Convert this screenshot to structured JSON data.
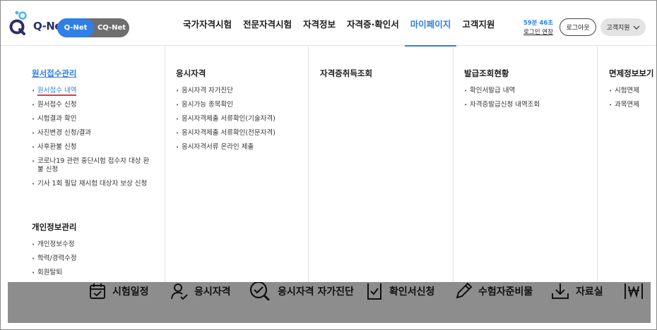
{
  "header": {
    "logo_text": "Q-Net",
    "switch": {
      "qnet": "Q-Net",
      "cqnet": "CQ-Net"
    },
    "nav": [
      {
        "label": "국가자격시험",
        "active": false
      },
      {
        "label": "전문자격시험",
        "active": false
      },
      {
        "label": "자격정보",
        "active": false
      },
      {
        "label": "자격증·확인서",
        "active": false
      },
      {
        "label": "마이페이지",
        "active": true
      },
      {
        "label": "고객지원",
        "active": false
      }
    ],
    "timer": {
      "remaining": "59분 46초",
      "extend_label": "로그인 연장"
    },
    "logout_label": "로그아웃",
    "support_label": "고객지원"
  },
  "menu": {
    "col1": {
      "title": "원서접수관리",
      "items": [
        "원서접수 내역",
        "원서접수 신청",
        "시험결과 확인",
        "사진변경 신청/결과",
        "사후환불 신청",
        "코로나19 관련 중단시험 접수자 대상 환불 신청",
        "기사 1회 필답 재시험 대상자 보상 신청"
      ]
    },
    "col1b": {
      "title": "개인정보관리",
      "items": [
        "개인정보수정",
        "학력/경력수정",
        "회원탈퇴"
      ]
    },
    "col2": {
      "title": "응시자격",
      "items": [
        "응시자격 자가진단",
        "응시가능 종목확인",
        "응시자격제출 서류확인(기술자격)",
        "응시자격제출 서류확인(전문자격)",
        "응시자격서류 온라인 제출"
      ]
    },
    "col3": {
      "title": "자격증취득조회",
      "items": []
    },
    "col4": {
      "title": "발급조회현황",
      "items": [
        "확인서발급 내역",
        "자격증발급신청 내역조회"
      ]
    },
    "col5": {
      "title": "면제정보보기",
      "items": [
        "시험면제",
        "과목면제"
      ]
    }
  },
  "quick": [
    {
      "label": "시험일정",
      "icon": "calendar-icon"
    },
    {
      "label": "응시자격",
      "icon": "person-icon"
    },
    {
      "label": "응시자격 자가진단",
      "icon": "search-check-icon"
    },
    {
      "label": "확인서신청",
      "icon": "document-check-icon"
    },
    {
      "label": "수험자준비물",
      "icon": "pencil-icon"
    },
    {
      "label": "자료실",
      "icon": "download-icon"
    }
  ],
  "colors": {
    "accent": "#2f7fe6",
    "active_underline": "#e33a3a",
    "quickbar_bg": "#8d8d8d"
  }
}
